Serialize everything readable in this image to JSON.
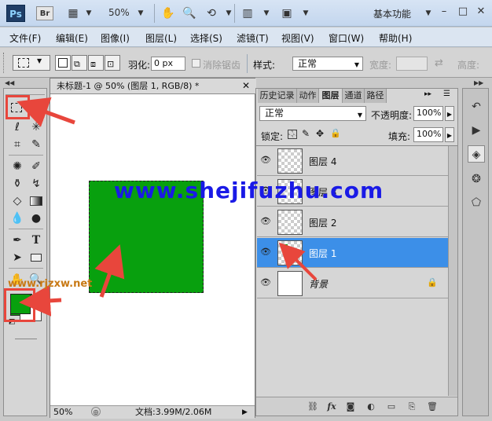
{
  "titlebar": {
    "ps_logo": "Ps",
    "br_logo": "Br",
    "zoom": "50%",
    "workspace": "基本功能",
    "icons": [
      "frame-icon",
      "hand-icon",
      "zoom-icon",
      "rotate-icon",
      "arrange-icon",
      "screen-mode-icon"
    ]
  },
  "menu": {
    "items": [
      "文件(F)",
      "编辑(E)",
      "图像(I)",
      "图层(L)",
      "选择(S)",
      "滤镜(T)",
      "视图(V)",
      "窗口(W)",
      "帮助(H)"
    ]
  },
  "options": {
    "feather_label": "羽化:",
    "feather_value": "0 px",
    "antialias_label": "消除锯齿",
    "style_label": "样式:",
    "style_value": "正常",
    "width_label": "宽度:",
    "height_label": "高度:"
  },
  "document": {
    "tab_title": "未标题-1 @ 50% (图层 1, RGB/8) *",
    "zoom": "50%",
    "doc_info": "文档:3.99M/2.06M"
  },
  "layers_panel": {
    "tabs": [
      "历史记录",
      "动作",
      "图层",
      "通道",
      "路径"
    ],
    "blend_mode": "正常",
    "opacity_label": "不透明度:",
    "opacity_value": "100%",
    "lock_label": "锁定:",
    "fill_label": "填充:",
    "fill_value": "100%",
    "layers": [
      "图层 4",
      "图层 3",
      "图层 2",
      "图层 1",
      "背景"
    ]
  },
  "colors": {
    "foreground": "#08a00e",
    "background": "#ffffff",
    "selection_highlight": "#3c8fe8",
    "annotation": "#e8463c"
  },
  "watermarks": {
    "main": "www.shejifuzhu.com",
    "secondary": "www.rjzxw.net"
  }
}
